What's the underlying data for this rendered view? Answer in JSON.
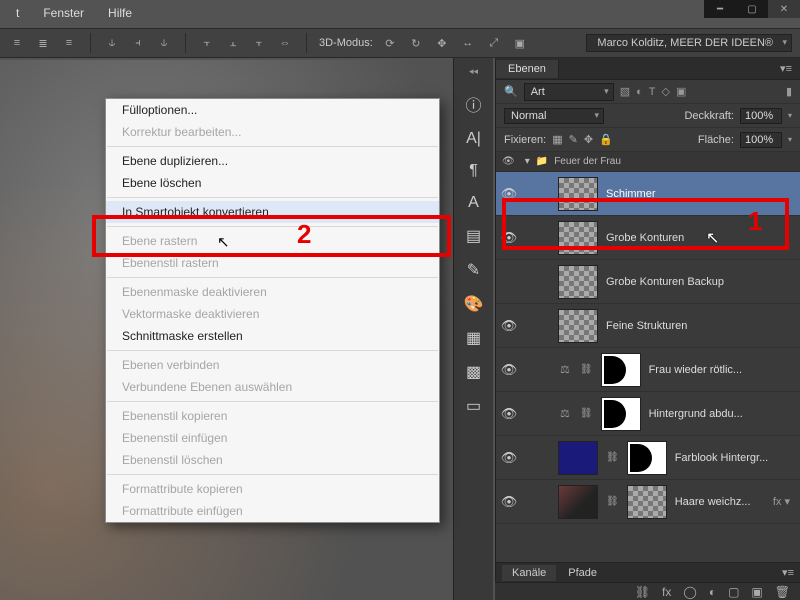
{
  "menubar": {
    "item0": "t",
    "item1": "Fenster",
    "item2": "Hilfe"
  },
  "optbar": {
    "mode_label": "3D-Modus:",
    "workspace": "Marco Kolditz, MEER DER IDEEN®"
  },
  "panel": {
    "title": "Ebenen",
    "kind_label": "Art",
    "blend_mode": "Normal",
    "opacity_label": "Deckkraft:",
    "opacity_value": "100%",
    "lock_label": "Fixieren:",
    "fill_label": "Fläche:",
    "fill_value": "100%",
    "group_name": "Feuer der Frau",
    "bottom_tabs": {
      "channels": "Kanäle",
      "paths": "Pfade"
    }
  },
  "layers": [
    {
      "name": "Schimmer",
      "selected": true,
      "eye": true,
      "thumb": "checker"
    },
    {
      "name": "Grobe Konturen",
      "selected": false,
      "eye": true,
      "thumb": "checker"
    },
    {
      "name": "Grobe Konturen Backup",
      "selected": false,
      "eye": false,
      "thumb": "checker"
    },
    {
      "name": "Feine Strukturen",
      "selected": false,
      "eye": true,
      "thumb": "checker"
    },
    {
      "name": "Frau wieder rötlic...",
      "selected": false,
      "eye": true,
      "thumb": "adjust",
      "mask": true
    },
    {
      "name": "Hintergrund abdu...",
      "selected": false,
      "eye": true,
      "thumb": "adjust",
      "mask": true
    },
    {
      "name": "Farblook Hintergr...",
      "selected": false,
      "eye": true,
      "thumb": "blue",
      "mask": true
    },
    {
      "name": "Haare weichz...",
      "selected": false,
      "eye": true,
      "thumb": "photo",
      "mask": true,
      "fx": true
    }
  ],
  "context_menu": {
    "i0": "Fülloptionen...",
    "i1": "Korrektur bearbeiten...",
    "i2": "Ebene duplizieren...",
    "i3": "Ebene löschen",
    "i4": "In Smartobjekt konvertieren",
    "i5": "Ebene rastern",
    "i6": "Ebenenstil rastern",
    "i7": "Ebenenmaske deaktivieren",
    "i8": "Vektormaske deaktivieren",
    "i9": "Schnittmaske erstellen",
    "i10": "Ebenen verbinden",
    "i11": "Verbundene Ebenen auswählen",
    "i12": "Ebenenstil kopieren",
    "i13": "Ebenenstil einfügen",
    "i14": "Ebenenstil löschen",
    "i15": "Formattribute kopieren",
    "i16": "Formattribute einfügen"
  },
  "annotations": {
    "num1": "1",
    "num2": "2"
  }
}
